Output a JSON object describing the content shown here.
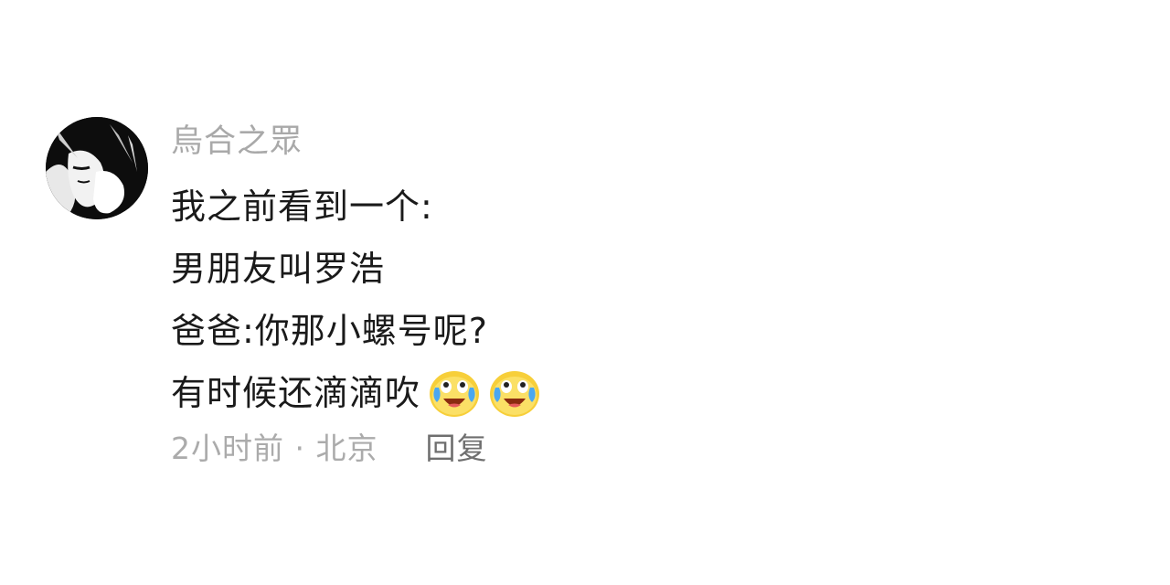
{
  "comment": {
    "username": "烏合之眾",
    "lines": [
      "我之前看到一个:",
      "男朋友叫罗浩",
      "爸爸:你那小螺号呢?",
      "有时候还滴滴吹"
    ],
    "emojis": [
      "crying-laughing-emoji",
      "crying-laughing-emoji"
    ],
    "timestamp_location": "2小时前 · 北京",
    "reply_label": "回复"
  },
  "colors": {
    "username": "#a9a9a9",
    "text": "#1a1a1a",
    "meta": "#ababab",
    "reply": "#6f6f6f",
    "emoji_face": "#f7cf3a"
  }
}
